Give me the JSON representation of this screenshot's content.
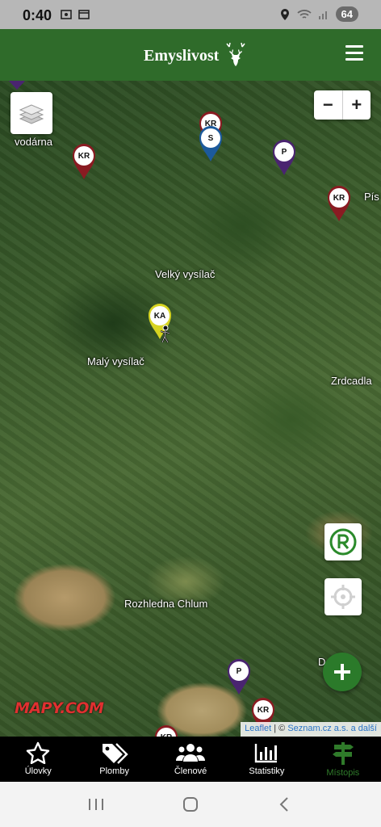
{
  "status_bar": {
    "time": "0:40",
    "battery": "64",
    "icons": [
      "screenshot-icon",
      "card-icon",
      "location-icon",
      "wifi-icon",
      "signal-icon"
    ]
  },
  "header": {
    "brand": "Emyslivost",
    "logo_icon": "deer-icon",
    "menu_icon": "hamburger-icon",
    "color": "#2f6b2a"
  },
  "map": {
    "labels": {
      "vodarna": "vodárna",
      "velky_vysilac": "Velký vysílač",
      "maly_vysilac": "Malý vysílač",
      "zrdcadla": "Zrdcadla",
      "rozhledna": "Rozhledna Chlum",
      "pis": "Pís",
      "d": "D"
    },
    "markers": [
      {
        "label": "KR",
        "color": "#8a1b22"
      },
      {
        "label": "KR",
        "color": "#8a1b22"
      },
      {
        "label": "S",
        "color": "#1c5a9c"
      },
      {
        "label": "P",
        "color": "#4a2470"
      },
      {
        "label": "KR",
        "color": "#8a1b22"
      },
      {
        "label": "KA",
        "color": "#d7d421"
      },
      {
        "label": "P",
        "color": "#4a2470"
      },
      {
        "label": "KR",
        "color": "#8a1b22"
      },
      {
        "label": "KR",
        "color": "#8a1b22"
      }
    ],
    "zoom_in": "+",
    "zoom_out": "−",
    "logo": "MAPY.COM",
    "attribution": {
      "leaflet": "Leaflet",
      "separator": " | © ",
      "provider": "Seznam.cz a.s. a další"
    }
  },
  "controls": {
    "register_icon": "registered-icon",
    "locate_icon": "crosshair-icon",
    "add_icon": "plus-icon"
  },
  "bottom_nav": {
    "items": [
      {
        "label": "Úlovky",
        "icon": "star-icon"
      },
      {
        "label": "Plomby",
        "icon": "tag-icon"
      },
      {
        "label": "Členové",
        "icon": "people-icon"
      },
      {
        "label": "Statistiky",
        "icon": "chart-icon"
      },
      {
        "label": "Místopis",
        "icon": "signpost-icon"
      }
    ],
    "active_color": "#2f7a2a"
  }
}
